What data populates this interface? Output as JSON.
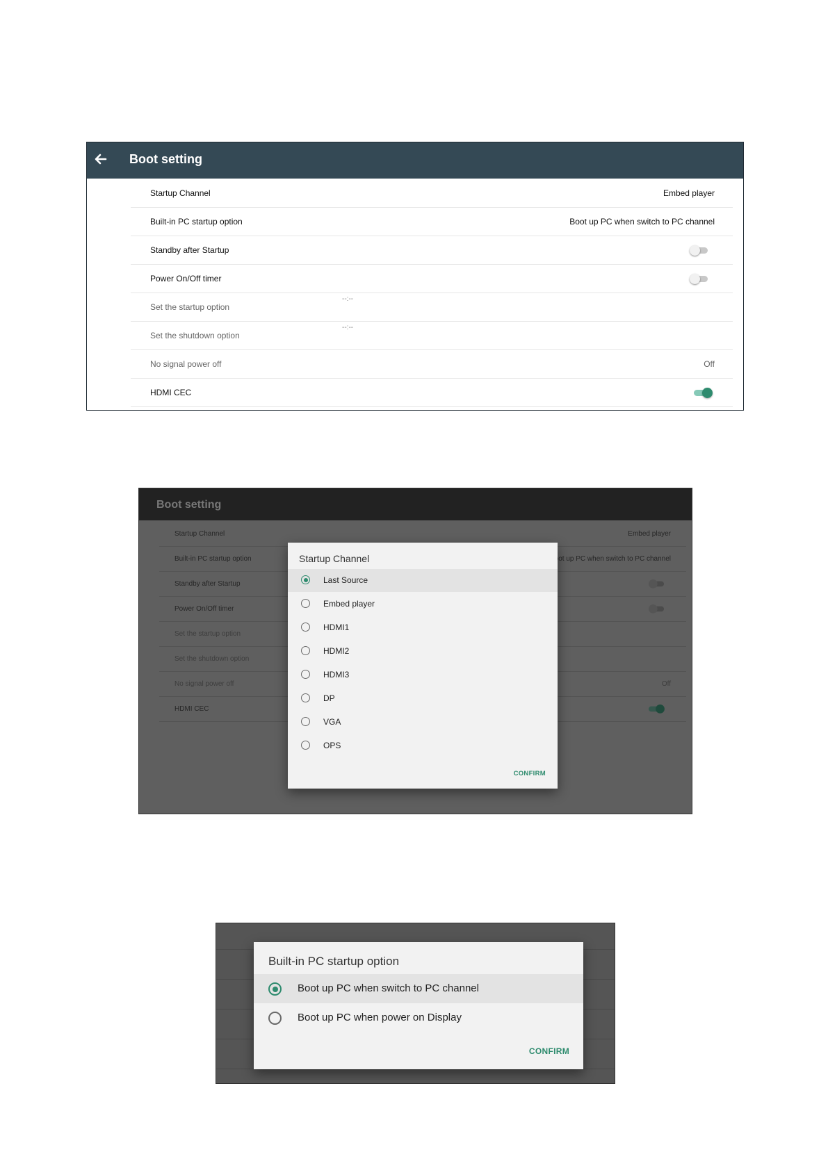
{
  "colors": {
    "appbar": "#344955",
    "accent": "#2e8b6e",
    "dim_overlay": "#5f5f5f",
    "dialog_bg": "#f2f2f2"
  },
  "screen1": {
    "title": "Boot setting",
    "back_icon": "arrow-left-icon",
    "rows": [
      {
        "label": "Startup Channel",
        "value": "Embed player"
      },
      {
        "label": "Built-in PC startup option",
        "value": "Boot up PC when switch to PC channel"
      },
      {
        "label": "Standby after Startup",
        "toggle": false
      },
      {
        "label": "Power On/Off timer",
        "toggle": false
      },
      {
        "label": "Set the startup option",
        "time": "--:--"
      },
      {
        "label": "Set the shutdown option",
        "time": "--:--"
      },
      {
        "label": "No signal power off",
        "value": "Off"
      },
      {
        "label": "HDMI CEC",
        "toggle": true
      }
    ]
  },
  "screen2": {
    "title": "Boot setting",
    "rows": [
      {
        "label": "Startup Channel",
        "value": "Embed player"
      },
      {
        "label": "Built-in PC startup option",
        "value": "Boot up PC when switch to PC channel"
      },
      {
        "label": "Standby after Startup",
        "toggle": false
      },
      {
        "label": "Power On/Off timer",
        "toggle": false
      },
      {
        "label": "Set the startup option"
      },
      {
        "label": "Set the shutdown option"
      },
      {
        "label": "No signal power off",
        "value": "Off"
      },
      {
        "label": "HDMI CEC",
        "toggle": true
      }
    ],
    "dialog": {
      "title": "Startup Channel",
      "selected": "Last Source",
      "options": [
        "Last Source",
        "Embed player",
        "HDMI1",
        "HDMI2",
        "HDMI3",
        "DP",
        "VGA",
        "OPS"
      ],
      "confirm": "CONFIRM"
    }
  },
  "screen3": {
    "dialog": {
      "title": "Built-in PC startup option",
      "selected": "Boot up PC when switch to PC channel",
      "options": [
        "Boot up PC when switch to PC channel",
        "Boot up PC when power on Display"
      ],
      "confirm": "CONFIRM"
    }
  }
}
